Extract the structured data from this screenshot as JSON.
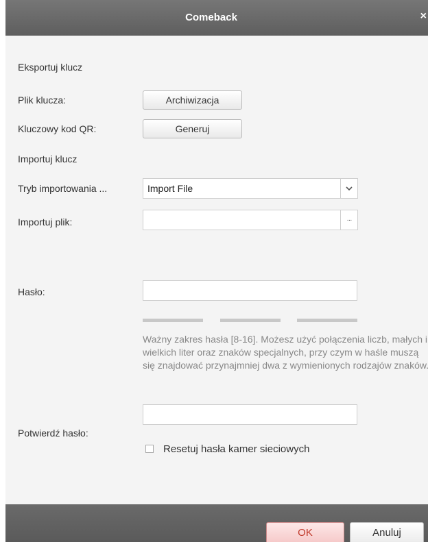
{
  "window": {
    "title": "Comeback",
    "close_glyph": "×"
  },
  "export_section": {
    "heading": "Eksportuj klucz",
    "key_file_label": "Plik klucza:",
    "archive_button": "Archiwizacja",
    "qr_label": "Kluczowy kod QR:",
    "generate_button": "Generuj"
  },
  "import_section": {
    "heading": "Importuj klucz",
    "mode_label": "Tryb importowania ...",
    "mode_value": "Import File",
    "file_label": "Importuj plik:",
    "file_value": "",
    "browse_glyph": "···"
  },
  "password": {
    "label": "Hasło:",
    "value": "",
    "hint": "Ważny zakres hasła [8-16]. Możesz użyć połączenia liczb, małych i wielkich liter oraz znaków specjalnych, przy czym w haśle muszą się znajdować przynajmniej dwa z wymienionych rodzajów znaków.",
    "confirm_label": "Potwierdź hasło:",
    "confirm_value": ""
  },
  "reset": {
    "label": "Resetuj hasła kamer sieciowych",
    "checked": false
  },
  "footer": {
    "ok_label": "OK",
    "cancel_label": "Anuluj"
  },
  "icons": {
    "close": "close-icon",
    "dropdown": "chevron-down-icon",
    "browse": "ellipsis-icon",
    "checkbox": "checkbox-icon"
  },
  "colors": {
    "titlebar": "#6b6b6b",
    "dialog_bg": "#f4f4f4",
    "ok_text": "#c0392b",
    "hint_text": "#888888"
  }
}
